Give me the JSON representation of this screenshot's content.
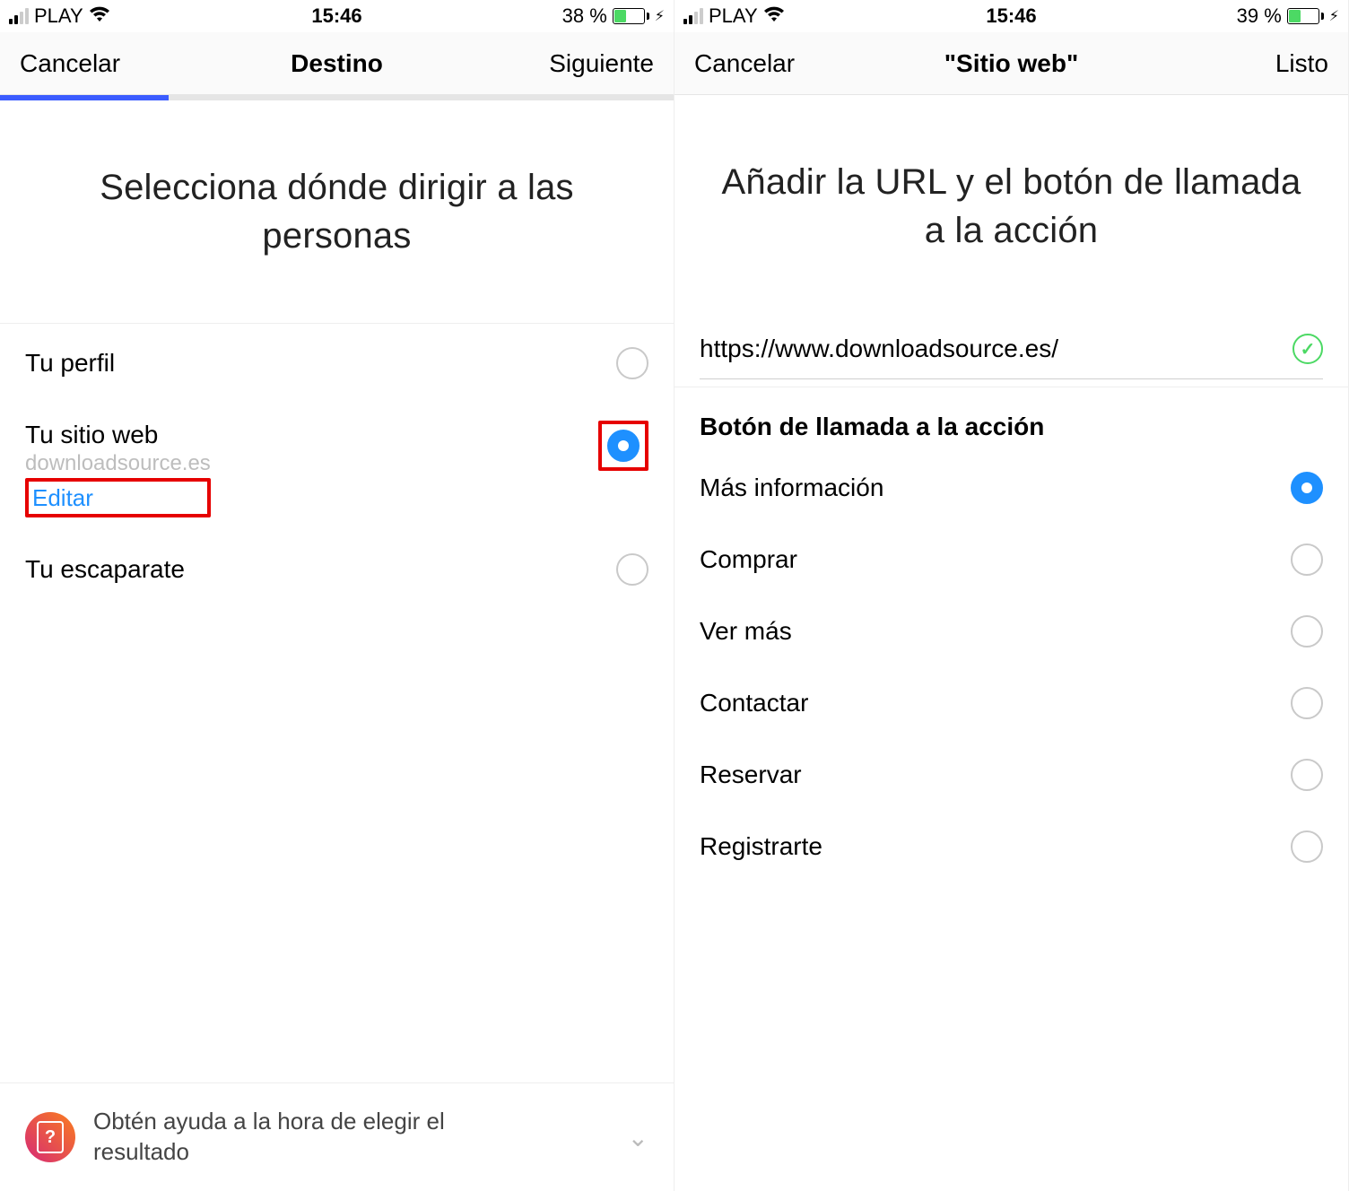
{
  "left": {
    "status": {
      "carrier": "PLAY",
      "time": "15:46",
      "battery_pct": "38 %"
    },
    "nav": {
      "cancel": "Cancelar",
      "title": "Destino",
      "next": "Siguiente"
    },
    "heading": "Selecciona dónde dirigir a las personas",
    "options": {
      "profile": "Tu perfil",
      "website_label": "Tu sitio web",
      "website_sub": "downloadsource.es",
      "website_edit": "Editar",
      "storefront": "Tu escaparate"
    },
    "help": "Obtén ayuda a la hora de elegir el resultado"
  },
  "right": {
    "status": {
      "carrier": "PLAY",
      "time": "15:46",
      "battery_pct": "39 %"
    },
    "nav": {
      "cancel": "Cancelar",
      "title": "\"Sitio web\"",
      "done": "Listo"
    },
    "heading": "Añadir la URL y el botón de llamada a la acción",
    "url": "https://www.downloadsource.es/",
    "cta_heading": "Botón de llamada a la acción",
    "cta": {
      "more_info": "Más información",
      "buy": "Comprar",
      "see_more": "Ver más",
      "contact": "Contactar",
      "book": "Reservar",
      "signup": "Registrarte"
    }
  }
}
